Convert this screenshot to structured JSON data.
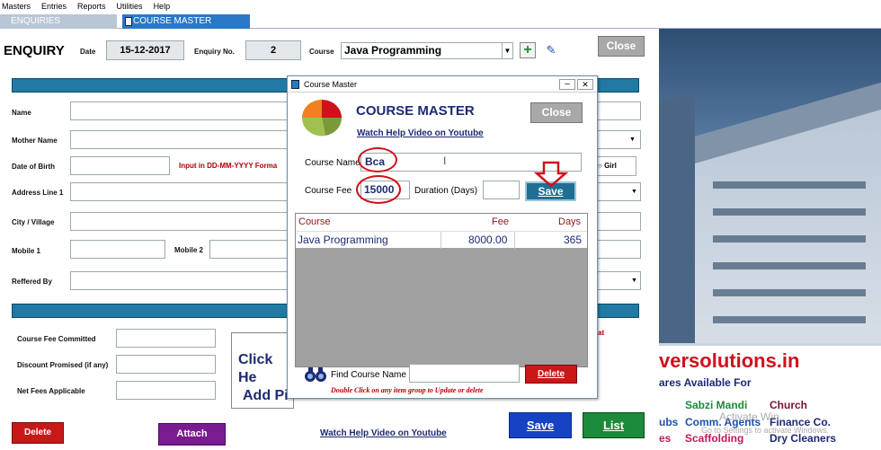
{
  "menu": [
    "Masters",
    "Entries",
    "Reports",
    "Utilities",
    "Help"
  ],
  "tabs": [
    {
      "label": "ENQUIRIES"
    },
    {
      "label": "COURSE MASTER"
    }
  ],
  "form": {
    "title": "ENQUIRY",
    "date_label": "Date",
    "date_value": "15-12-2017",
    "enq_label": "Enquiry No.",
    "enq_value": "2",
    "course_label": "Course",
    "course_value": "Java Programming",
    "close_label": "Close",
    "name_label": "Name",
    "mother_label": "Mother Name",
    "dob_label": "Date of Birth",
    "dob_hint": "Input in DD-MM-YYYY Forma",
    "girl_label": "Girl",
    "address_label": "Address Line 1",
    "city_label": "City / Village",
    "mobile1_label": "Mobile 1",
    "mobile2_label": "Mobile 2",
    "referred_label": "Reffered By",
    "fee_committed_label": "Course Fee Committed",
    "discount_label": "Discount Promised (if any)",
    "net_fees_label": "Net Fees Applicable",
    "photo_text_line1": "Click He",
    "photo_text_line2": "Add Pi",
    "stray_text": "at",
    "delete_label": "Delete",
    "attach_label": "Attach",
    "help_link": "Watch Help Video on Youtube",
    "save_label": "Save",
    "list_label": "List"
  },
  "background": {
    "brand": "versolutions.in",
    "tagline": "ares Available For",
    "services": [
      "Sabzi Mandi",
      "Church",
      "Comm. Agents",
      "Finance Co.",
      "Scaffolding",
      "Dry Cleaners"
    ],
    "left_fragments": [
      "ubs",
      "es"
    ],
    "watermark_line1": "Activate Win",
    "watermark_line2": "Go to Settings to activate Windows."
  },
  "dialog": {
    "window_title": "Course Master",
    "heading": "COURSE MASTER",
    "help_link": "Watch Help Video on Youtube",
    "close_label": "Close",
    "course_name_label": "Course Name",
    "course_name_value": "Bca",
    "course_fee_label": "Course Fee",
    "course_fee_value": "15000",
    "duration_label": "Duration (Days)",
    "duration_value": "",
    "save_label": "Save",
    "columns": [
      "Course",
      "Fee",
      "Days"
    ],
    "rows": [
      {
        "course": "Java Programming",
        "fee": "8000.00",
        "days": "365"
      }
    ],
    "find_label": "Find Course Name",
    "find_value": "",
    "delete_label": "Delete",
    "hint": "Double Click on any item group to Update or delete"
  },
  "colors": {
    "accent": "#217aa3",
    "tab": "#2a78c8",
    "red": "#d0101c",
    "save_blue": "#1565c0",
    "list_green": "#1b8a3a",
    "attach_purple": "#7a1b8f"
  }
}
